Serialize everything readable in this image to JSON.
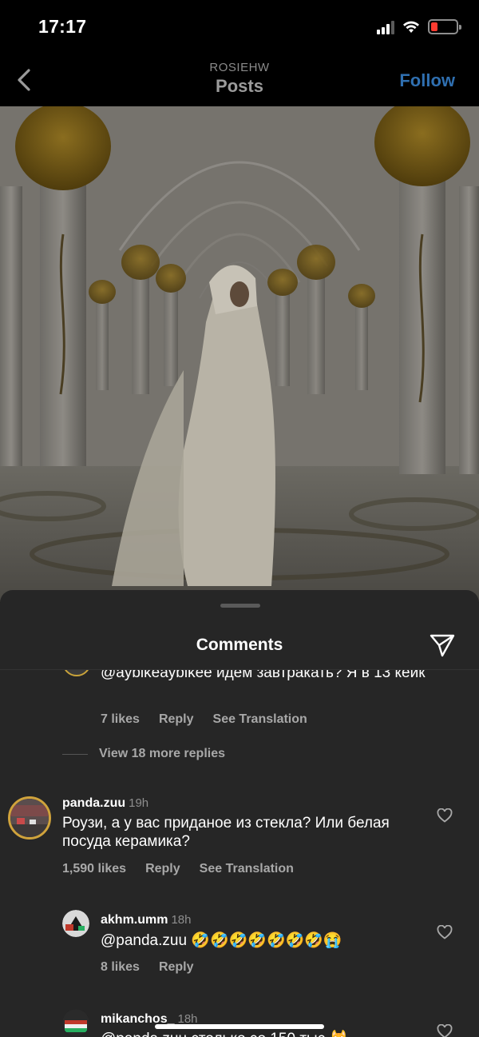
{
  "status_bar": {
    "time": "17:17"
  },
  "nav": {
    "subtitle": "ROSIEHW",
    "title": "Posts",
    "follow_label": "Follow"
  },
  "sheet": {
    "title": "Comments"
  },
  "comments": [
    {
      "text": "@aybikeaybikee идем завтракать? Я в 13 кейк",
      "likes": "7 likes",
      "reply_label": "Reply",
      "translate_label": "See Translation"
    },
    {
      "view_more": "View 18 more replies"
    },
    {
      "user": "panda.zuu",
      "time": "19h",
      "text": "Роузи, а  у вас приданое из стекла? Или белая посуда керамика?",
      "likes": "1,590 likes",
      "reply_label": "Reply",
      "translate_label": "See Translation"
    },
    {
      "user": "akhm.umm",
      "time": "18h",
      "text": "@panda.zuu 🤣🤣🤣🤣🤣🤣🤣😭",
      "likes": "8 likes",
      "reply_label": "Reply"
    },
    {
      "user": "mikanchos_",
      "time": "18h",
      "text": "@panda.zuu столько со 150 тыс 🙀"
    }
  ],
  "colors": {
    "accent": "#2f6fb0",
    "sheet_bg": "#262626",
    "muted": "#a8a8a8"
  }
}
